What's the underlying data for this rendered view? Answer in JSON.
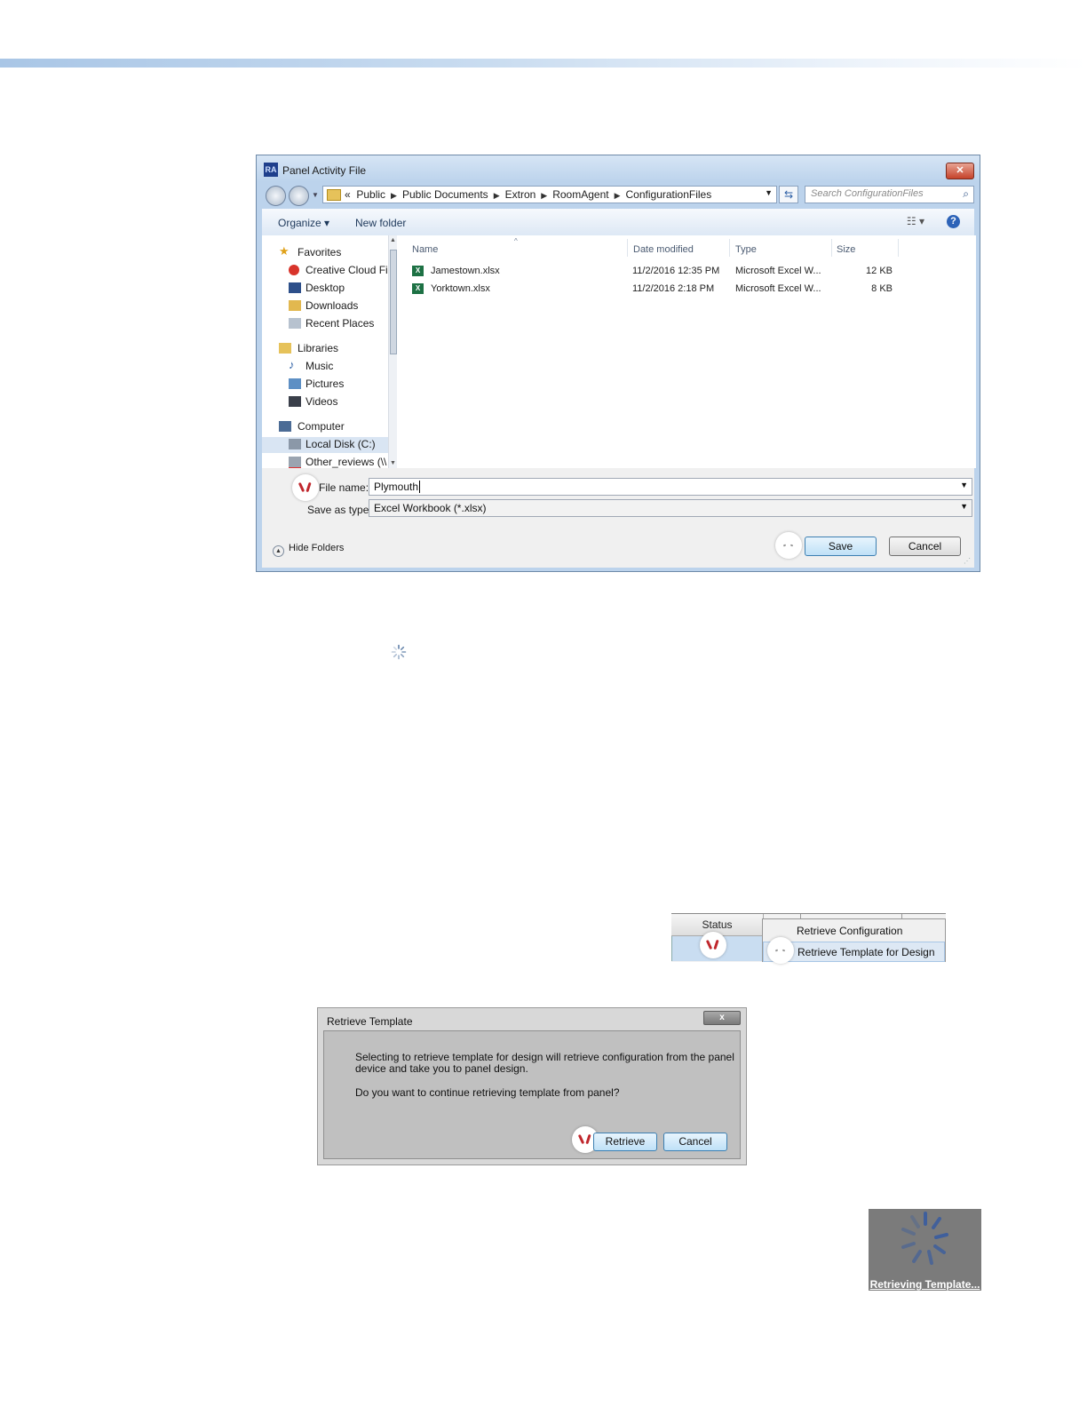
{
  "save_dialog": {
    "title": "Panel Activity File",
    "app_icon": "RA",
    "breadcrumb": [
      "«",
      "Public",
      "Public Documents",
      "Extron",
      "RoomAgent",
      "ConfigurationFiles"
    ],
    "search_placeholder": "Search ConfigurationFiles",
    "toolbar": {
      "organize": "Organize ▾",
      "new_folder": "New folder"
    },
    "nav": {
      "favorites": "Favorites",
      "creative_cloud": "Creative Cloud Fi",
      "desktop": "Desktop",
      "downloads": "Downloads",
      "recent_places": "Recent Places",
      "libraries": "Libraries",
      "music": "Music",
      "pictures": "Pictures",
      "videos": "Videos",
      "computer": "Computer",
      "local_disk": "Local Disk (C:)",
      "other_reviews": "Other_reviews (\\\\"
    },
    "columns": {
      "name": "Name",
      "date_modified": "Date modified",
      "type": "Type",
      "size": "Size"
    },
    "files": [
      {
        "name": "Jamestown.xlsx",
        "date": "11/2/2016 12:35 PM",
        "type": "Microsoft Excel W...",
        "size": "12 KB"
      },
      {
        "name": "Yorktown.xlsx",
        "date": "11/2/2016 2:18 PM",
        "type": "Microsoft Excel W...",
        "size": "8 KB"
      }
    ],
    "file_name_label": "File name:",
    "file_name_value": "Plymouth",
    "save_type_label": "Save as type:",
    "save_type_value": "Excel Workbook (*.xlsx)",
    "hide_folders": "Hide Folders",
    "save_button": "Save",
    "cancel_button": "Cancel"
  },
  "context_menu": {
    "status_header": "Status",
    "items": [
      "Retrieve Configuration",
      "Retrieve Template for Design"
    ]
  },
  "retrieve_dialog": {
    "title": "Retrieve Template",
    "close": "x",
    "message_line1": "Selecting to retrieve template for design will retrieve configuration from the panel",
    "message_line2": "device and take you to panel design.",
    "question": "Do you want to continue retrieving template from panel?",
    "retrieve_button": "Retrieve",
    "cancel_button": "Cancel"
  },
  "retrieving_overlay": {
    "label": "Retrieving Template..."
  },
  "colors": {
    "accent_blue": "#3c7fb1",
    "callout_red": "#c0272d",
    "overlay_gray": "#7b7b7b"
  }
}
